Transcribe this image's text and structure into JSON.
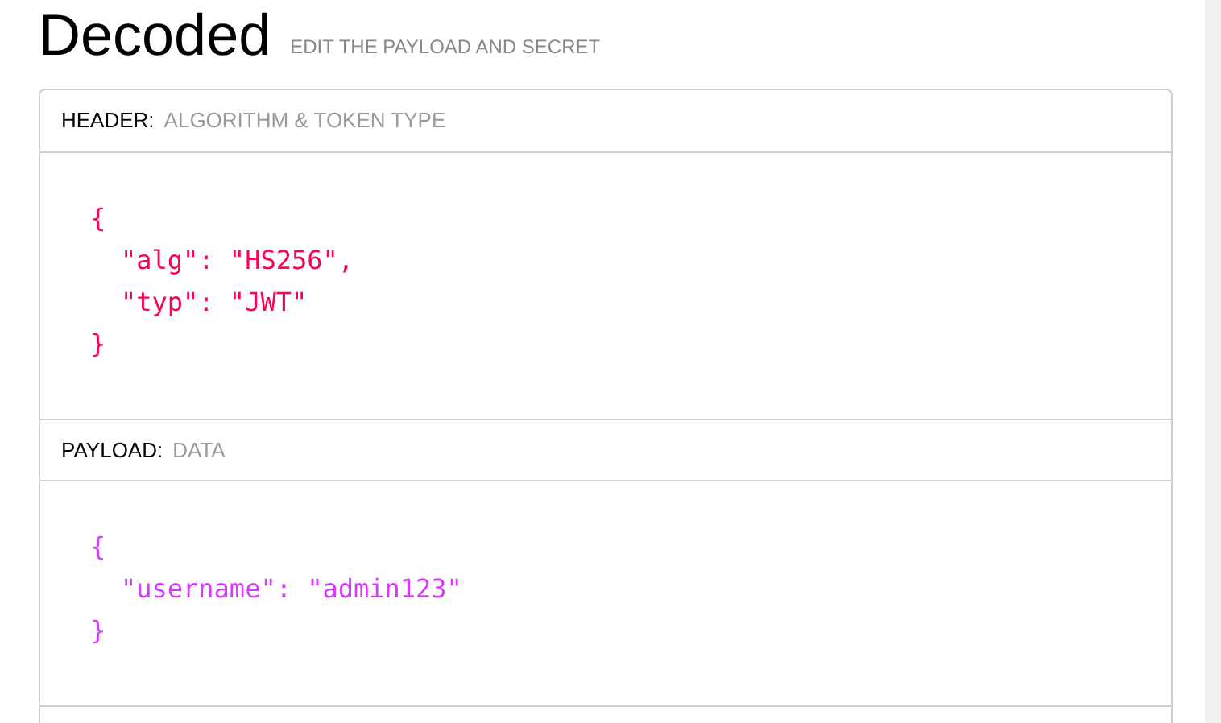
{
  "heading": {
    "title": "Decoded",
    "subtitle": "EDIT THE PAYLOAD AND SECRET"
  },
  "sections": [
    {
      "label": "HEADER:",
      "hint": "ALGORITHM & TOKEN TYPE",
      "color": "#fb015b",
      "code": {
        "open": "{",
        "entries": [
          "\"alg\": \"HS256\",",
          "\"typ\": \"JWT\""
        ],
        "close": "}"
      }
    },
    {
      "label": "PAYLOAD:",
      "hint": "DATA",
      "color": "#d63aff",
      "code": {
        "open": "{",
        "entries": [
          "\"username\": \"admin123\""
        ],
        "close": "}"
      }
    }
  ]
}
